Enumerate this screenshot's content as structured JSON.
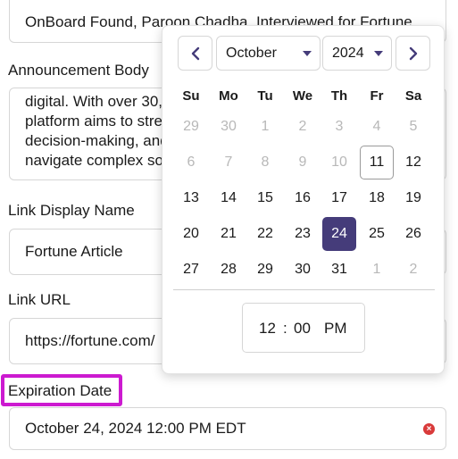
{
  "form": {
    "title_value": "OnBoard Found, Paroon Chadha, Interviewed for Fortune",
    "announcement_label": "Announcement Body",
    "announcement_lines": [
      "digital. With over 30,",
      "platform aims to stre",
      "decision-making, and",
      "navigate complex soc"
    ],
    "link_name_label": "Link Display Name",
    "link_name_value": "Fortune Article",
    "link_url_label": "Link URL",
    "link_url_value": "https://fortune.com/",
    "expiration_label": "Expiration Date",
    "expiration_value": "October 24, 2024 12:00 PM EDT",
    "clear_icon": "clear-icon",
    "accent_color": "#cc1ad0"
  },
  "datepicker": {
    "month": "October",
    "year": "2024",
    "prev_icon": "chevron-left-icon",
    "next_icon": "chevron-right-icon",
    "weekdays": [
      "Su",
      "Mo",
      "Tu",
      "We",
      "Th",
      "Fr",
      "Sa"
    ],
    "weeks": [
      [
        "29",
        "30",
        "1",
        "2",
        "3",
        "4",
        "5"
      ],
      [
        "6",
        "7",
        "8",
        "9",
        "10",
        "11",
        "12"
      ],
      [
        "13",
        "14",
        "15",
        "16",
        "17",
        "18",
        "19"
      ],
      [
        "20",
        "21",
        "22",
        "23",
        "24",
        "25",
        "26"
      ],
      [
        "27",
        "28",
        "29",
        "30",
        "31",
        "1",
        "2"
      ]
    ],
    "muted": [
      [
        true,
        true,
        true,
        true,
        true,
        true,
        true
      ],
      [
        true,
        true,
        true,
        true,
        true,
        false,
        false
      ],
      [
        false,
        false,
        false,
        false,
        false,
        false,
        false
      ],
      [
        false,
        false,
        false,
        false,
        false,
        false,
        false
      ],
      [
        false,
        false,
        false,
        false,
        false,
        true,
        true
      ]
    ],
    "today": "11",
    "selected": "24",
    "selected_color": "#453c7a",
    "time": {
      "hour": "12",
      "separator": ":",
      "minute": "00",
      "period": "PM"
    }
  }
}
